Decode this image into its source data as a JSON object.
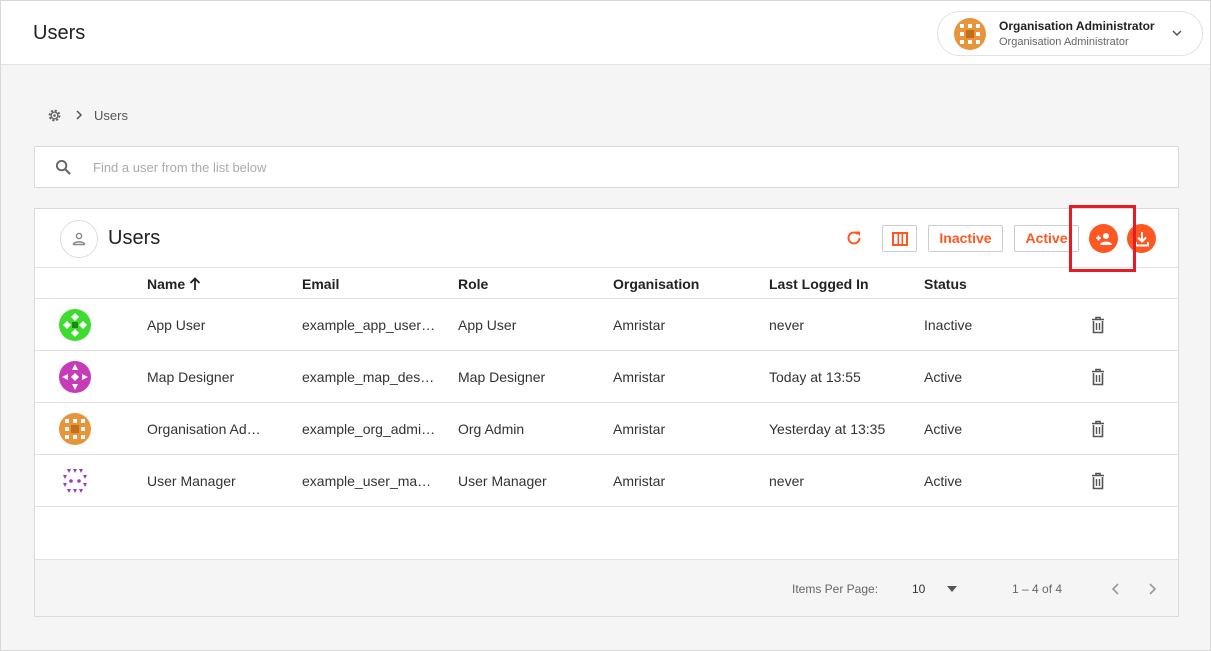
{
  "header": {
    "title": "Users",
    "user": {
      "name": "Organisation Administrator",
      "role": "Organisation Administrator"
    }
  },
  "breadcrumb": {
    "current": "Users"
  },
  "search": {
    "placeholder": "Find a user from the list below"
  },
  "card": {
    "title": "Users",
    "inactive_label": "Inactive",
    "active_label": "Active"
  },
  "table": {
    "columns": {
      "name": "Name",
      "email": "Email",
      "role": "Role",
      "organisation": "Organisation",
      "last_logged_in": "Last Logged In",
      "status": "Status"
    },
    "rows": [
      {
        "name": "App User",
        "email": "example_app_user…",
        "role": "App User",
        "organisation": "Amristar",
        "last_logged_in": "never",
        "status": "Inactive"
      },
      {
        "name": "Map Designer",
        "email": "example_map_desi…",
        "role": "Map Designer",
        "organisation": "Amristar",
        "last_logged_in": "Today at 13:55",
        "status": "Active"
      },
      {
        "name": "Organisation Adm…",
        "email": "example_org_admin…",
        "role": "Org Admin",
        "organisation": "Amristar",
        "last_logged_in": "Yesterday at 13:35",
        "status": "Active"
      },
      {
        "name": "User Manager",
        "email": "example_user_man…",
        "role": "User Manager",
        "organisation": "Amristar",
        "last_logged_in": "never",
        "status": "Active"
      }
    ]
  },
  "pagination": {
    "items_per_page_label": "Items Per Page:",
    "items_per_page": "10",
    "range": "1 – 4 of 4"
  },
  "colors": {
    "accent": "#ff5722",
    "highlight": "#e51c23",
    "avatar_green": "#3ddc2e",
    "avatar_magenta": "#c63bb8",
    "avatar_orange": "#e8943a",
    "avatar_purple": "#9c3cb8"
  }
}
